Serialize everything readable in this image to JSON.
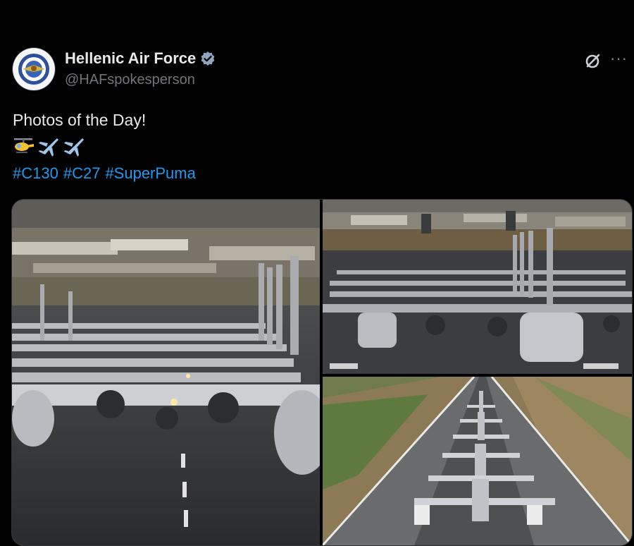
{
  "post": {
    "author": {
      "display_name": "Hellenic Air Force",
      "handle": "@HAFspokesperson",
      "verified": true,
      "avatar_icon": "air-force-emblem-icon"
    },
    "header_actions": {
      "grok_icon": "grok-icon",
      "more_icon": "more-icon",
      "more_label": "···"
    },
    "text": "Photos of the Day!",
    "emojis": [
      "helicopter-emoji",
      "airplane-emoji",
      "airplane-emoji"
    ],
    "hashtags": [
      "#C130",
      "#C27",
      "#SuperPuma"
    ],
    "media": [
      {
        "name": "photo-c130-elephant-walk",
        "description_icon": "photo"
      },
      {
        "name": "photo-aircraft-rows-front",
        "description_icon": "photo"
      },
      {
        "name": "photo-runway-lineup",
        "description_icon": "photo"
      }
    ]
  },
  "colors": {
    "background": "#000000",
    "text": "#e7e9ea",
    "secondary_text": "#71767b",
    "link": "#1d9bf0",
    "verified_badge": "#8ea5bd"
  }
}
